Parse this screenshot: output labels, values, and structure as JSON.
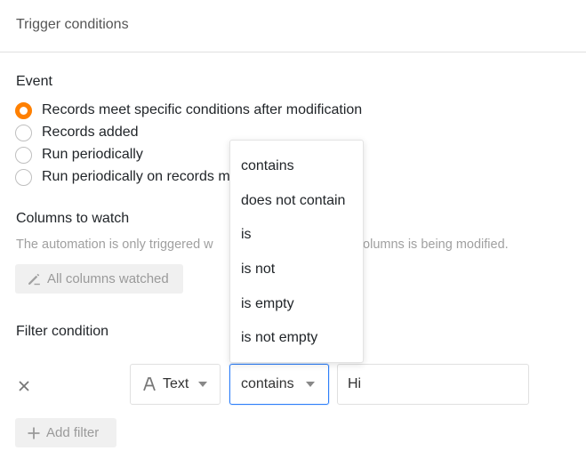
{
  "header": {
    "title": "Trigger conditions"
  },
  "event": {
    "label": "Event",
    "options": [
      {
        "label": "Records meet specific conditions after modification",
        "selected": true
      },
      {
        "label": "Records added",
        "selected": false
      },
      {
        "label": "Run periodically",
        "selected": false
      },
      {
        "label": "Run periodically on records m",
        "selected": false
      }
    ]
  },
  "columns": {
    "label": "Columns to watch",
    "hint": "The automation is only triggered w                                   ed columns is being modified.",
    "button": "All columns watched",
    "button_icon": "pencil-icon"
  },
  "filter": {
    "label": "Filter condition",
    "column_name": "Text",
    "column_icon": "text-column-icon",
    "operator": "contains",
    "value": "Hi",
    "add_button": "Add filter",
    "operator_options": [
      "contains",
      "does not contain",
      "is",
      "is not",
      "is empty",
      "is not empty"
    ]
  },
  "colors": {
    "accent": "#ff8000",
    "focus": "#2d7ff9",
    "muted_text": "#a0a0a0"
  }
}
